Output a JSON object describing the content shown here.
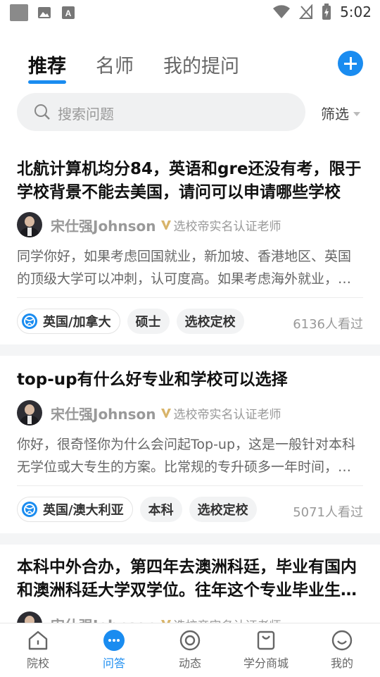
{
  "status_bar": {
    "time": "5:02"
  },
  "tabs": [
    {
      "label": "推荐",
      "active": true
    },
    {
      "label": "名师",
      "active": false
    },
    {
      "label": "我的提问",
      "active": false
    }
  ],
  "search": {
    "placeholder": "搜索问题",
    "filter_label": "筛选"
  },
  "questions": [
    {
      "title": "北航计算机均分84，英语和gre还没有考，限于学校背景不能去美国，请问可以申请哪些学校",
      "teacher_name": "宋仕强Johnson",
      "teacher_cert": "选校帝实名认证老师",
      "answer": "同学你好，如果考虑回国就业，新加坡、香港地区、英国的顶级大学可以冲刺，认可度高。如果考虑海外就业，可以选择加拿大、澳洲等移民友好的国家。",
      "tags": [
        "英国/加拿大",
        "硕士",
        "选校定校"
      ],
      "views": "6136人看过"
    },
    {
      "title": "top-up有什么好专业和学校可以选择",
      "teacher_name": "宋仕强Johnson",
      "teacher_cert": "选校帝实名认证老师",
      "answer": "你好，很奇怪你为什么会问起Top-up，这是一般针对本科无学位或大专生的方案。比常规的专升硕多一年时间，但可以拿到本科学位。",
      "tags": [
        "英国/澳大利亚",
        "本科",
        "选校定校"
      ],
      "views": "5071人看过"
    },
    {
      "title": "本科中外合办，第四年去澳洲科廷，毕业有国内和澳洲科廷大学双学位。往年这个专业毕业生的去向如何",
      "teacher_name": "宋仕强Johnson",
      "teacher_cert": "选校帝实名认证老师"
    }
  ],
  "bottom_nav": [
    {
      "label": "院校",
      "icon": "home-icon",
      "active": false
    },
    {
      "label": "问答",
      "icon": "chat-bubble-icon",
      "active": true
    },
    {
      "label": "动态",
      "icon": "target-icon",
      "active": false
    },
    {
      "label": "学分商城",
      "icon": "shopping-bag-icon",
      "active": false
    },
    {
      "label": "我的",
      "icon": "smile-icon",
      "active": false
    }
  ],
  "colors": {
    "accent": "#1a8cf0",
    "gold_badge": "#d8b46a"
  }
}
